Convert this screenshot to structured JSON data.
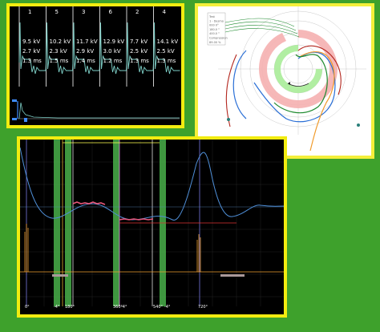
{
  "ignition_panel": {
    "cylinders": [
      {
        "num": "1",
        "kv1": "9.5 kV",
        "kv2": "2.7 kV",
        "ms": "1.3 ms"
      },
      {
        "num": "5",
        "kv1": "10.2 kV",
        "kv2": "2.3 kV",
        "ms": "1.5 ms"
      },
      {
        "num": "3",
        "kv1": "11.7 kV",
        "kv2": "2.9 kV",
        "ms": "1.4 ms"
      },
      {
        "num": "6",
        "kv1": "12.9 kV",
        "kv2": "3.0 kV",
        "ms": "1.2 ms"
      },
      {
        "num": "2",
        "kv1": "7.7 kV",
        "kv2": "2.5 kV",
        "ms": "1.3 ms"
      },
      {
        "num": "4",
        "kv1": "14.1 kV",
        "kv2": "2.5 kV",
        "ms": "1.3 ms"
      }
    ],
    "colors": {
      "trace": "#7ed0c8",
      "marker": "#3f8cff",
      "divider": "#ffffff"
    }
  },
  "polar_panel": {
    "legend_lines": [
      "Test",
      "1 - Desmo",
      "000 0°",
      "180.0 °",
      "400.0 °",
      "Compression",
      "89.00 %"
    ],
    "colors": {
      "red": "#f2a0a0",
      "green": "#9ee58a",
      "blue": "#2a6fd6",
      "orange": "#f09a2a",
      "darkred": "#b3261e",
      "dkgreen": "#1d8a2e"
    }
  },
  "timing_panel": {
    "bottom_labels": [
      "0°",
      "-4°",
      "180°",
      "360°",
      "-4°",
      "540°",
      "-4°",
      "720°"
    ],
    "colors": {
      "blue_trace": "#4f8fd8",
      "green_band": "#49b04a",
      "pink": "#e8567a",
      "red": "#d33",
      "orange": "#f0a030",
      "yellow": "#ffff50"
    }
  }
}
